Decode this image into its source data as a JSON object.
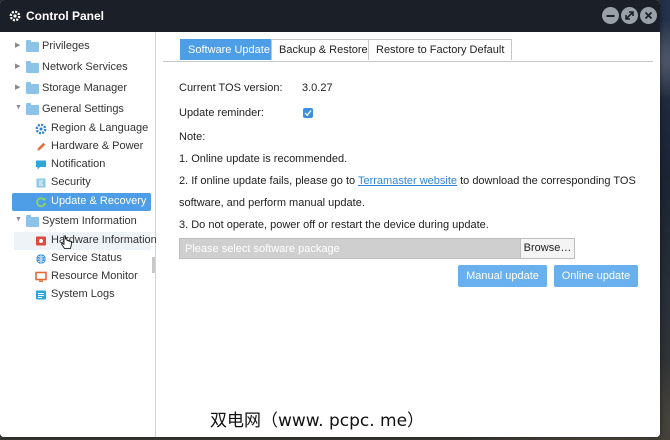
{
  "window": {
    "title": "Control Panel"
  },
  "titlebar_buttons": [
    "minimize",
    "maximize",
    "close"
  ],
  "colors": {
    "accent": "#4d9ee6",
    "button": "#69b0ee",
    "link": "#2f86d8",
    "titlebar": "#1b1f27"
  },
  "sidebar": {
    "groups": [
      {
        "label": "Privileges",
        "expanded": false,
        "icon": "folder-icon"
      },
      {
        "label": "Network Services",
        "expanded": false,
        "icon": "folder-icon"
      },
      {
        "label": "Storage Manager",
        "expanded": false,
        "icon": "folder-icon"
      },
      {
        "label": "General Settings",
        "expanded": true,
        "icon": "folder-icon",
        "items": [
          {
            "label": "Region & Language",
            "icon": "gear-icon"
          },
          {
            "label": "Hardware & Power",
            "icon": "pencil-icon"
          },
          {
            "label": "Notification",
            "icon": "chat-bubble-icon"
          },
          {
            "label": "Security",
            "icon": "shield-icon"
          },
          {
            "label": "Update & Recovery",
            "icon": "refresh-icon",
            "selected": true
          }
        ]
      },
      {
        "label": "System Information",
        "expanded": true,
        "icon": "folder-icon",
        "items": [
          {
            "label": "Hardware Information",
            "icon": "chip-icon"
          },
          {
            "label": "Service Status",
            "icon": "globe-icon"
          },
          {
            "label": "Resource Monitor",
            "icon": "monitor-icon"
          },
          {
            "label": "System Logs",
            "icon": "log-icon"
          }
        ]
      }
    ]
  },
  "tabs": [
    {
      "label": "Software Update",
      "active": true
    },
    {
      "label": "Backup & Restore",
      "active": false
    },
    {
      "label": "Restore to Factory Default",
      "active": false
    }
  ],
  "update": {
    "tos_version_label": "Current TOS version:",
    "tos_version_value": "3.0.27",
    "reminder_label": "Update reminder:",
    "reminder_checked": true,
    "note_title": "Note:",
    "note1": "1. Online update is recommended.",
    "note2_prefix": "2. If online update fails, please go to ",
    "note2_link": "Terramaster website",
    "note2_suffix": " to download the corresponding TOS",
    "note2_line2": "software, and perform manual update.",
    "note3": "3. Do not operate, power off or restart the device during update.",
    "file_placeholder": "Please select software package",
    "browse_label": "Browse…",
    "manual_update_label": "Manual update",
    "online_update_label": "Online update"
  },
  "watermark": "双电网（www. pcpc. me）"
}
